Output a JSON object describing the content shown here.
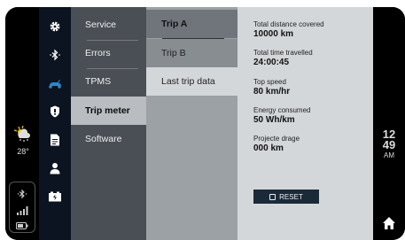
{
  "status": {
    "weather_icon": "cloud-snow-icon",
    "temperature": "28°",
    "bluetooth_icon": "bluetooth-icon",
    "signal_icon": "signal-bars-icon",
    "battery_icon": "battery-icon"
  },
  "nav_icons": [
    "gear-icon",
    "bluetooth-icon",
    "scooter-icon",
    "shield-icon",
    "document-icon",
    "user-icon",
    "battery-charge-icon"
  ],
  "accent_color": "#2f86c8",
  "menu": {
    "items": [
      "Service",
      "Errors",
      "TPMS",
      "Trip meter",
      "Software"
    ],
    "active": "Trip meter"
  },
  "submenu": {
    "items": [
      "Trip A",
      "Trip B",
      "Last trip data"
    ],
    "active": "Trip A"
  },
  "details": {
    "stats": [
      {
        "label": "Total distance covered",
        "value": "10000 km"
      },
      {
        "label": "Total time travelled",
        "value": "24:00:45"
      },
      {
        "label": "Top speed",
        "value": "80 km/hr"
      },
      {
        "label": "Energy consumed",
        "value": "50 Wh/km"
      },
      {
        "label": "Projecte drage",
        "value": "000 km"
      }
    ],
    "reset_label": "RESET"
  },
  "clock": {
    "hour": "12",
    "minute": "49",
    "ampm": "AM"
  }
}
